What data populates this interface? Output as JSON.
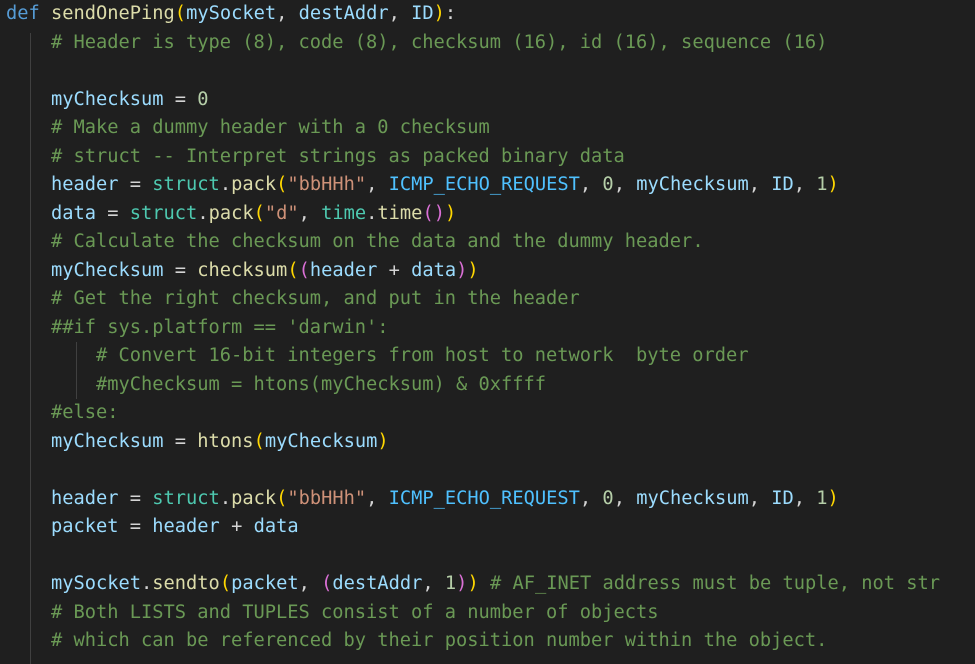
{
  "editor": {
    "language": "python",
    "theme_colors": {
      "background": "#1f1f1f",
      "keyword": "#569cd6",
      "function": "#dcdcaa",
      "variable": "#9cdcfe",
      "plain": "#d4d4d4",
      "number": "#b5cea8",
      "string": "#ce9178",
      "constant": "#4fc1ff",
      "class": "#4ec9b0",
      "comment": "#6a9955",
      "bracket_1": "#ffd700",
      "bracket_2": "#da70d6",
      "bracket_3": "#179fff"
    },
    "lines": [
      {
        "indent": 0,
        "tokens": [
          [
            "kw",
            "def"
          ],
          [
            "txt",
            " "
          ],
          [
            "fn",
            "sendOnePing"
          ],
          [
            "b1",
            "("
          ],
          [
            "var",
            "mySocket"
          ],
          [
            "txt",
            ", "
          ],
          [
            "var",
            "destAddr"
          ],
          [
            "txt",
            ", "
          ],
          [
            "var",
            "ID"
          ],
          [
            "b1",
            ")"
          ],
          [
            "txt",
            ":"
          ]
        ]
      },
      {
        "indent": 4,
        "tokens": [
          [
            "com",
            "# Header is type (8), code (8), checksum (16), id (16), sequence (16)"
          ]
        ]
      },
      {
        "indent": 0,
        "tokens": []
      },
      {
        "indent": 4,
        "tokens": [
          [
            "var",
            "myChecksum"
          ],
          [
            "txt",
            " = "
          ],
          [
            "num",
            "0"
          ]
        ]
      },
      {
        "indent": 4,
        "tokens": [
          [
            "com",
            "# Make a dummy header with a 0 checksum"
          ]
        ]
      },
      {
        "indent": 4,
        "tokens": [
          [
            "com",
            "# struct -- Interpret strings as packed binary data"
          ]
        ]
      },
      {
        "indent": 4,
        "tokens": [
          [
            "var",
            "header"
          ],
          [
            "txt",
            " = "
          ],
          [
            "cls",
            "struct"
          ],
          [
            "txt",
            "."
          ],
          [
            "fn",
            "pack"
          ],
          [
            "b1",
            "("
          ],
          [
            "str",
            "\"bbHHh\""
          ],
          [
            "txt",
            ", "
          ],
          [
            "const",
            "ICMP_ECHO_REQUEST"
          ],
          [
            "txt",
            ", "
          ],
          [
            "num",
            "0"
          ],
          [
            "txt",
            ", "
          ],
          [
            "var",
            "myChecksum"
          ],
          [
            "txt",
            ", "
          ],
          [
            "var",
            "ID"
          ],
          [
            "txt",
            ", "
          ],
          [
            "num",
            "1"
          ],
          [
            "b1",
            ")"
          ]
        ]
      },
      {
        "indent": 4,
        "tokens": [
          [
            "var",
            "data"
          ],
          [
            "txt",
            " = "
          ],
          [
            "cls",
            "struct"
          ],
          [
            "txt",
            "."
          ],
          [
            "fn",
            "pack"
          ],
          [
            "b1",
            "("
          ],
          [
            "str",
            "\"d\""
          ],
          [
            "txt",
            ", "
          ],
          [
            "cls",
            "time"
          ],
          [
            "txt",
            "."
          ],
          [
            "fn",
            "time"
          ],
          [
            "b2",
            "()"
          ],
          [
            "b1",
            ")"
          ]
        ]
      },
      {
        "indent": 4,
        "tokens": [
          [
            "com",
            "# Calculate the checksum on the data and the dummy header."
          ]
        ]
      },
      {
        "indent": 4,
        "tokens": [
          [
            "var",
            "myChecksum"
          ],
          [
            "txt",
            " = "
          ],
          [
            "fn",
            "checksum"
          ],
          [
            "b1",
            "("
          ],
          [
            "b2",
            "("
          ],
          [
            "var",
            "header"
          ],
          [
            "txt",
            " + "
          ],
          [
            "var",
            "data"
          ],
          [
            "b2",
            ")"
          ],
          [
            "b1",
            ")"
          ]
        ]
      },
      {
        "indent": 4,
        "tokens": [
          [
            "com",
            "# Get the right checksum, and put in the header"
          ]
        ]
      },
      {
        "indent": 4,
        "tokens": [
          [
            "com",
            "##if sys.platform == 'darwin':"
          ]
        ]
      },
      {
        "indent": 8,
        "tokens": [
          [
            "com",
            "# Convert 16-bit integers from host to network  byte order"
          ]
        ]
      },
      {
        "indent": 8,
        "tokens": [
          [
            "com",
            "#myChecksum = htons(myChecksum) & 0xffff"
          ]
        ]
      },
      {
        "indent": 4,
        "tokens": [
          [
            "com",
            "#else:"
          ]
        ]
      },
      {
        "indent": 4,
        "tokens": [
          [
            "var",
            "myChecksum"
          ],
          [
            "txt",
            " = "
          ],
          [
            "fn",
            "htons"
          ],
          [
            "b1",
            "("
          ],
          [
            "var",
            "myChecksum"
          ],
          [
            "b1",
            ")"
          ]
        ]
      },
      {
        "indent": 0,
        "tokens": []
      },
      {
        "indent": 4,
        "tokens": [
          [
            "var",
            "header"
          ],
          [
            "txt",
            " = "
          ],
          [
            "cls",
            "struct"
          ],
          [
            "txt",
            "."
          ],
          [
            "fn",
            "pack"
          ],
          [
            "b1",
            "("
          ],
          [
            "str",
            "\"bbHHh\""
          ],
          [
            "txt",
            ", "
          ],
          [
            "const",
            "ICMP_ECHO_REQUEST"
          ],
          [
            "txt",
            ", "
          ],
          [
            "num",
            "0"
          ],
          [
            "txt",
            ", "
          ],
          [
            "var",
            "myChecksum"
          ],
          [
            "txt",
            ", "
          ],
          [
            "var",
            "ID"
          ],
          [
            "txt",
            ", "
          ],
          [
            "num",
            "1"
          ],
          [
            "b1",
            ")"
          ]
        ]
      },
      {
        "indent": 4,
        "tokens": [
          [
            "var",
            "packet"
          ],
          [
            "txt",
            " = "
          ],
          [
            "var",
            "header"
          ],
          [
            "txt",
            " + "
          ],
          [
            "var",
            "data"
          ]
        ]
      },
      {
        "indent": 0,
        "tokens": []
      },
      {
        "indent": 4,
        "tokens": [
          [
            "var",
            "mySocket"
          ],
          [
            "txt",
            "."
          ],
          [
            "fn",
            "sendto"
          ],
          [
            "b1",
            "("
          ],
          [
            "var",
            "packet"
          ],
          [
            "txt",
            ", "
          ],
          [
            "b2",
            "("
          ],
          [
            "var",
            "destAddr"
          ],
          [
            "txt",
            ", "
          ],
          [
            "num",
            "1"
          ],
          [
            "b2",
            ")"
          ],
          [
            "b1",
            ")"
          ],
          [
            "txt",
            " "
          ],
          [
            "com",
            "# AF_INET address must be tuple, not str"
          ]
        ]
      },
      {
        "indent": 4,
        "tokens": [
          [
            "com",
            "# Both LISTS and TUPLES consist of a number of objects"
          ]
        ]
      },
      {
        "indent": 4,
        "tokens": [
          [
            "com",
            "# which can be referenced by their position number within the object."
          ]
        ]
      }
    ]
  }
}
